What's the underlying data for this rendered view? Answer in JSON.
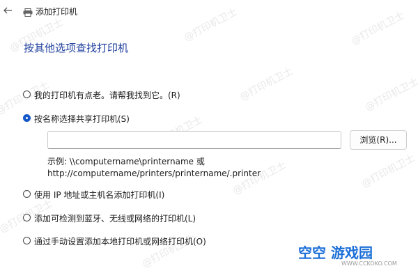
{
  "titlebar": {
    "title": "添加打印机"
  },
  "heading": "按其他选项查找打印机",
  "options": [
    {
      "label": "我的打印机有点老。请帮我找到它。(R)",
      "checked": false
    },
    {
      "label": "按名称选择共享打印机(S)",
      "checked": true
    },
    {
      "label": "使用 IP 地址或主机名添加打印机(I)",
      "checked": false
    },
    {
      "label": "添加可检测到蓝牙、无线或网络的打印机(L)",
      "checked": false
    },
    {
      "label": "通过手动设置添加本地打印机或网络打印机(O)",
      "checked": false
    }
  ],
  "shared_input": {
    "value": "",
    "browse_label": "浏览(R)..."
  },
  "example": {
    "line1": "示例: \\\\computername\\printername 或",
    "line2": "http://computername/printers/printername/.printer"
  },
  "watermark": "@打印机卫士",
  "logo": {
    "name": "空空 游戏园",
    "url": "WWW.CCKOKO.COM"
  }
}
